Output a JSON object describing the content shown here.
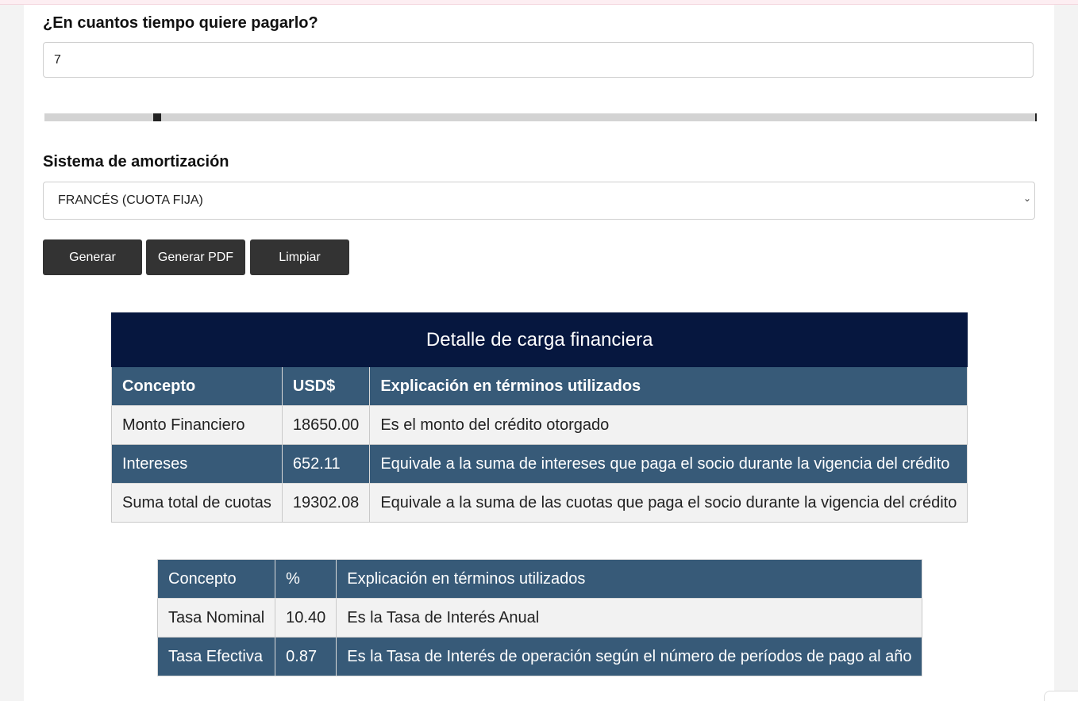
{
  "term_field": {
    "label": "¿En cuantos tiempo quiere pagarlo?",
    "value": "7"
  },
  "term_slider": {
    "value_fraction": 0.114
  },
  "amortization": {
    "label": "Sistema de amortización",
    "selected": "FRANCÉS (CUOTA FIJA)"
  },
  "buttons": {
    "generate": "Generar",
    "generate_pdf": "Generar PDF",
    "clear": "Limpiar"
  },
  "financial_table": {
    "title": "Detalle de carga financiera",
    "headers": [
      "Concepto",
      "USD$",
      "Explicación en términos utilizados"
    ],
    "rows": [
      [
        "Monto Financiero",
        "18650.00",
        "Es el monto del crédito otorgado"
      ],
      [
        "Intereses",
        "652.11",
        "Equivale a la suma de intereses que paga el socio durante la vigencia del crédito"
      ],
      [
        "Suma total de cuotas",
        "19302.08",
        "Equivale a la suma de las cuotas que paga el socio durante la vigencia del crédito"
      ]
    ]
  },
  "rate_table": {
    "headers": [
      "Concepto",
      "%",
      "Explicación en términos utilizados"
    ],
    "rows": [
      [
        "Tasa Nominal",
        "10.40",
        "Es la Tasa de Interés Anual"
      ],
      [
        "Tasa Efectiva",
        "0.87",
        "Es la Tasa de Interés de operación según el número de períodos de pago al año"
      ]
    ]
  },
  "colors": {
    "title_bg": "#06173f",
    "header_bg": "#375a78",
    "button_bg": "#333333"
  }
}
